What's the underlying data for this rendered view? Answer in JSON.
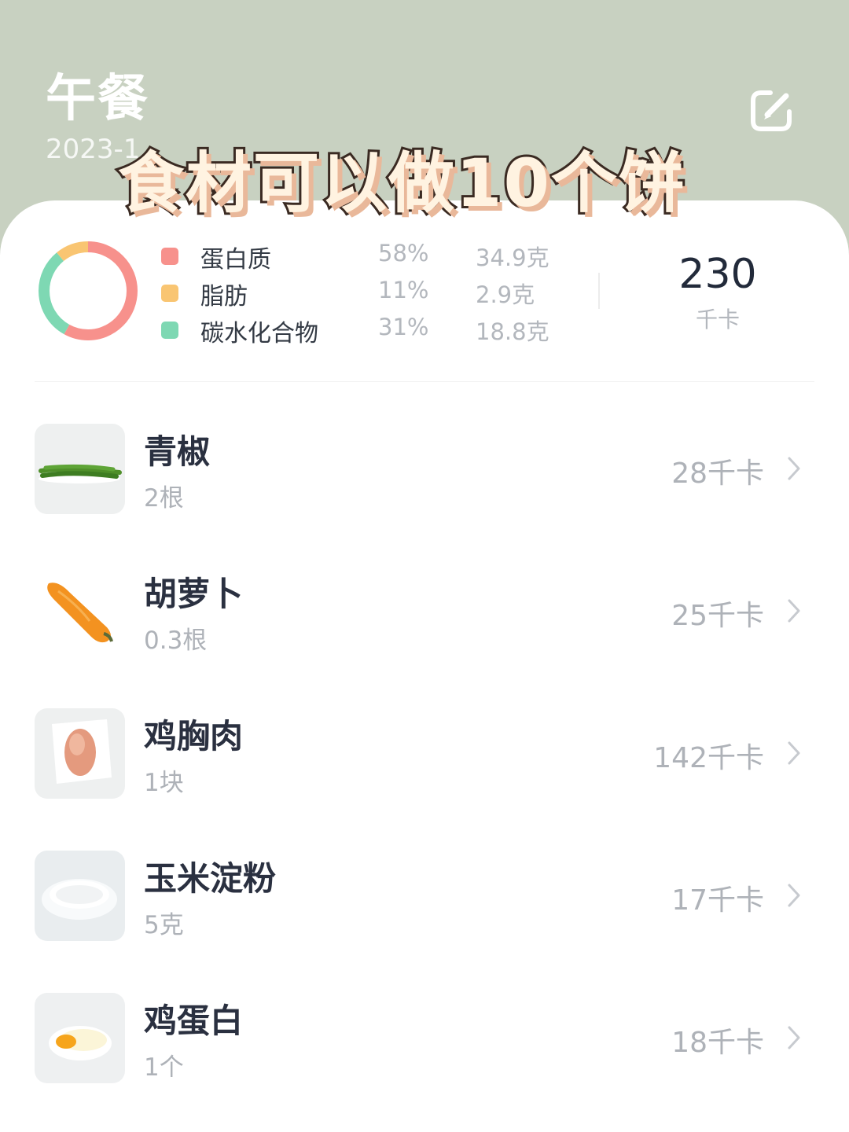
{
  "header": {
    "title": "午餐",
    "date": "2023-1"
  },
  "overlay_caption": "食材可以做10个饼",
  "summary": {
    "macros": [
      {
        "name": "蛋白质",
        "percent": "58%",
        "amount": "34.9克",
        "color": "#f7918c",
        "fraction": 0.58
      },
      {
        "name": "脂肪",
        "percent": "11%",
        "amount": "2.9克",
        "color": "#f9c572",
        "fraction": 0.11
      },
      {
        "name": "碳水化合物",
        "percent": "31%",
        "amount": "18.8克",
        "color": "#7ed8b3",
        "fraction": 0.31
      }
    ],
    "total_kcal": "230",
    "kcal_unit": "千卡"
  },
  "foods": [
    {
      "name": "青椒",
      "qty": "2根",
      "kcal": "28千卡",
      "icon": "green-pepper-photo"
    },
    {
      "name": "胡萝卜",
      "qty": "0.3根",
      "kcal": "25千卡",
      "icon": "carrot-photo"
    },
    {
      "name": "鸡胸肉",
      "qty": "1块",
      "kcal": "142千卡",
      "icon": "chicken-breast-photo"
    },
    {
      "name": "玉米淀粉",
      "qty": "5克",
      "kcal": "17千卡",
      "icon": "corn-starch-photo"
    },
    {
      "name": "鸡蛋白",
      "qty": "1个",
      "kcal": "18千卡",
      "icon": "egg-white-photo"
    }
  ]
}
